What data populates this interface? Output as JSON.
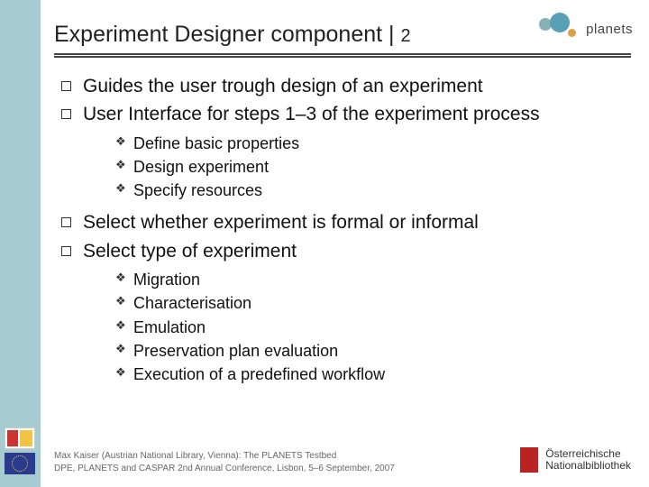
{
  "header": {
    "title_main": "Experiment Designer component | ",
    "title_num": "2",
    "logo_text": "planets"
  },
  "bullets": {
    "b1": "Guides the user trough design of an experiment",
    "b2": "User Interface for steps 1–3 of the experiment process",
    "b2_s1": "Define basic properties",
    "b2_s2": "Design experiment",
    "b2_s3": "Specify resources",
    "b3": "Select whether experiment is formal or informal",
    "b4": "Select type of experiment",
    "b4_s1": "Migration",
    "b4_s2": "Characterisation",
    "b4_s3": "Emulation",
    "b4_s4": "Preservation plan evaluation",
    "b4_s5": "Execution of a predefined workflow"
  },
  "footer": {
    "line1": "Max Kaiser (Austrian National Library, Vienna): The PLANETS Testbed",
    "line2": "DPE, PLANETS and CASPAR 2nd Annual Conference, Lisbon, 5–6 September, 2007"
  },
  "onb": {
    "line1": "Österreichische",
    "line2": "Nationalbibliothek"
  }
}
